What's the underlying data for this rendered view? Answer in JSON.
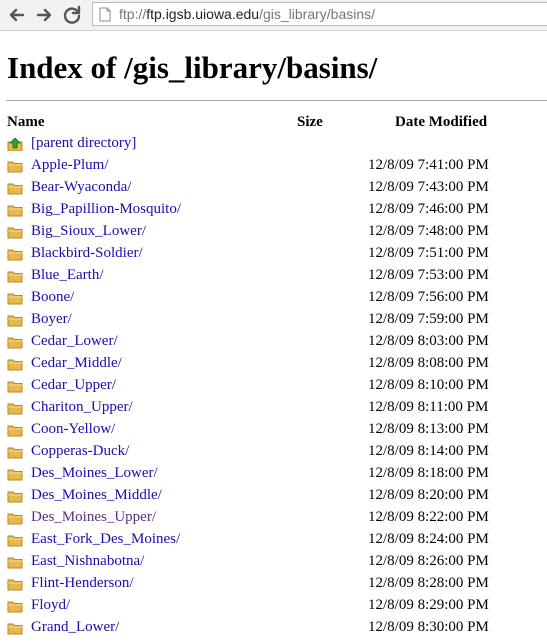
{
  "browser": {
    "url_domain": "ftp.igsb.uiowa.edu",
    "url_prefix": "ftp://",
    "url_path": "/gis_library/basins/"
  },
  "page": {
    "title": "Index of /gis_library/basins/",
    "columns": {
      "name": "Name",
      "size": "Size",
      "date": "Date Modified"
    },
    "parent_label": "[parent directory]"
  },
  "entries": [
    {
      "name": "Apple-Plum/",
      "date": "12/8/09 7:41:00 PM"
    },
    {
      "name": "Bear-Wyaconda/",
      "date": "12/8/09 7:43:00 PM"
    },
    {
      "name": "Big_Papillion-Mosquito/",
      "date": "12/8/09 7:46:00 PM"
    },
    {
      "name": "Big_Sioux_Lower/",
      "date": "12/8/09 7:48:00 PM"
    },
    {
      "name": "Blackbird-Soldier/",
      "date": "12/8/09 7:51:00 PM"
    },
    {
      "name": "Blue_Earth/",
      "date": "12/8/09 7:53:00 PM"
    },
    {
      "name": "Boone/",
      "date": "12/8/09 7:56:00 PM"
    },
    {
      "name": "Boyer/",
      "date": "12/8/09 7:59:00 PM"
    },
    {
      "name": "Cedar_Lower/",
      "date": "12/8/09 8:03:00 PM"
    },
    {
      "name": "Cedar_Middle/",
      "date": "12/8/09 8:08:00 PM"
    },
    {
      "name": "Cedar_Upper/",
      "date": "12/8/09 8:10:00 PM"
    },
    {
      "name": "Chariton_Upper/",
      "date": "12/8/09 8:11:00 PM"
    },
    {
      "name": "Coon-Yellow/",
      "date": "12/8/09 8:13:00 PM"
    },
    {
      "name": "Copperas-Duck/",
      "date": "12/8/09 8:14:00 PM"
    },
    {
      "name": "Des_Moines_Lower/",
      "date": "12/8/09 8:18:00 PM"
    },
    {
      "name": "Des_Moines_Middle/",
      "date": "12/8/09 8:20:00 PM"
    },
    {
      "name": "Des_Moines_Upper/",
      "date": "12/8/09 8:22:00 PM",
      "visited": true
    },
    {
      "name": "East_Fork_Des_Moines/",
      "date": "12/8/09 8:24:00 PM"
    },
    {
      "name": "East_Nishnabotna/",
      "date": "12/8/09 8:26:00 PM"
    },
    {
      "name": "Flint-Henderson/",
      "date": "12/8/09 8:28:00 PM"
    },
    {
      "name": "Floyd/",
      "date": "12/8/09 8:29:00 PM"
    },
    {
      "name": "Grand_Lower/",
      "date": "12/8/09 8:30:00 PM"
    }
  ],
  "colors": {
    "link": "#1a0dab",
    "visited": "#5a2d82",
    "folder": "#e8b84a",
    "parent_arrow": "#2aa52a"
  },
  "icons": {
    "back": "back-arrow-icon",
    "forward": "forward-arrow-icon",
    "reload": "reload-icon",
    "page": "page-icon",
    "folder": "folder-icon",
    "parent": "up-arrow-icon"
  }
}
